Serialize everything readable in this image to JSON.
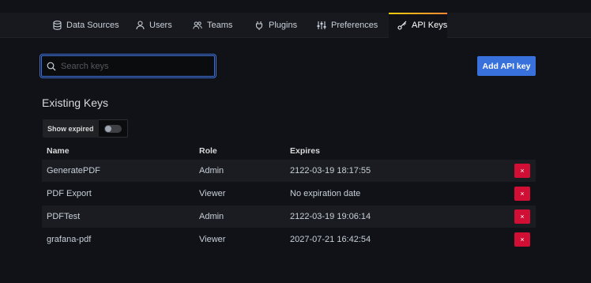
{
  "tabs": [
    {
      "label": "Data Sources",
      "icon": "database-icon",
      "active": false
    },
    {
      "label": "Users",
      "icon": "user-icon",
      "active": false
    },
    {
      "label": "Teams",
      "icon": "users-icon",
      "active": false
    },
    {
      "label": "Plugins",
      "icon": "plug-icon",
      "active": false
    },
    {
      "label": "Preferences",
      "icon": "sliders-icon",
      "active": false
    },
    {
      "label": "API Keys",
      "icon": "key-icon",
      "active": true
    }
  ],
  "search": {
    "placeholder": "Search keys",
    "value": ""
  },
  "add_button": "Add API key",
  "section_title": "Existing Keys",
  "show_expired": {
    "label": "Show expired",
    "enabled": false
  },
  "table": {
    "columns": [
      "Name",
      "Role",
      "Expires"
    ],
    "rows": [
      {
        "name": "GeneratePDF",
        "role": "Admin",
        "expires": "2122-03-19 18:17:55"
      },
      {
        "name": "PDF Export",
        "role": "Viewer",
        "expires": "No expiration date"
      },
      {
        "name": "PDFTest",
        "role": "Admin",
        "expires": "2122-03-19 19:06:14"
      },
      {
        "name": "grafana-pdf",
        "role": "Viewer",
        "expires": "2027-07-21 16:42:54"
      }
    ],
    "delete_label": "×"
  },
  "colors": {
    "primary": "#3871dc",
    "danger": "#d10e33",
    "background": "#111217",
    "tab_accent": "#ff8833"
  }
}
